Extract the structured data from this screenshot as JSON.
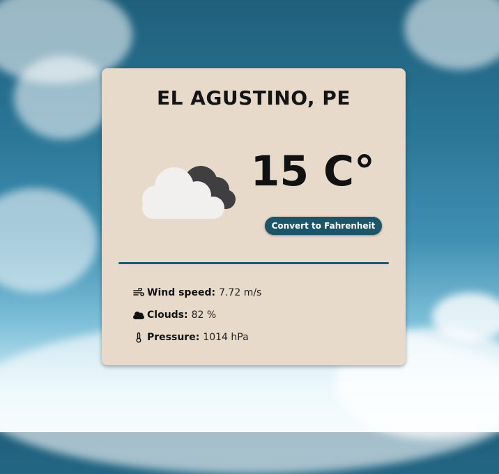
{
  "weather": {
    "city": "EL AGUSTINO, PE",
    "temperature": "15 C°",
    "condition_icon": "cloud-icon",
    "convert_label": "Convert to Fahrenheit"
  },
  "details": {
    "wind": {
      "label": "Wind speed:",
      "value": "7.72 m/s",
      "icon": "wind-icon"
    },
    "clouds": {
      "label": "Clouds:",
      "value": "82 %",
      "icon": "cloud-icon"
    },
    "pressure": {
      "label": "Pressure:",
      "value": "1014 hPa",
      "icon": "thermometer-icon"
    }
  },
  "colors": {
    "card_background": "#e8dacb",
    "button_background": "#1c5468",
    "divider": "#1f5670"
  }
}
